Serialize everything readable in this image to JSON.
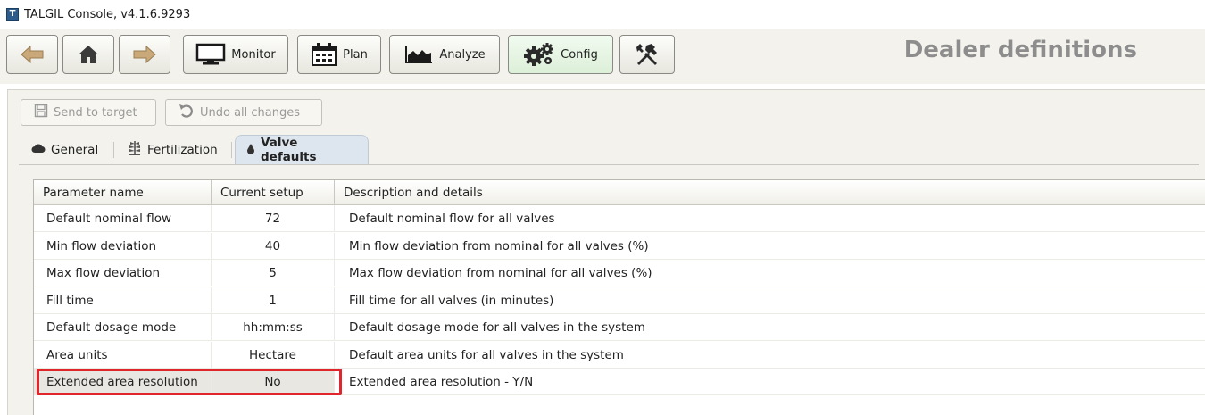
{
  "window": {
    "title": "TALGIL Console, v4.1.6.9293",
    "app_icon_glyph": "T"
  },
  "toolbar": {
    "back_icon": "arrow-left-icon",
    "home_icon": "home-icon",
    "forward_icon": "arrow-right-icon",
    "monitor_label": "Monitor",
    "plan_label": "Plan",
    "analyze_label": "Analyze",
    "config_label": "Config",
    "tools_icon": "tools-icon",
    "page_title": "Dealer definitions"
  },
  "actions": {
    "send_label": "Send to target",
    "undo_label": "Undo all changes"
  },
  "tabs": [
    {
      "label": "General",
      "icon": "cloud-icon"
    },
    {
      "label": "Fertilization",
      "icon": "plant-icon"
    },
    {
      "label": "Valve defaults",
      "icon": "drop-icon",
      "selected": true
    }
  ],
  "table": {
    "headers": [
      "Parameter name",
      "Current setup",
      "Description and details"
    ],
    "rows": [
      {
        "name": "Default nominal flow",
        "value": "72",
        "desc": "Default nominal  flow  for all valves"
      },
      {
        "name": "Min flow deviation",
        "value": "40",
        "desc": "Min flow deviation from nominal for all valves (%)"
      },
      {
        "name": "Max flow deviation",
        "value": "5",
        "desc": "Max flow deviation from nominal for all valves (%)"
      },
      {
        "name": "Fill time",
        "value": "1",
        "desc": "Fill time for all valves (in minutes)"
      },
      {
        "name": "Default dosage mode",
        "value": "hh:mm:ss",
        "desc": "Default dosage mode for all valves in the system"
      },
      {
        "name": "Area units",
        "value": "Hectare",
        "desc": "Default area units for all valves in the system"
      },
      {
        "name": "Extended area resolution",
        "value": "No",
        "desc": "Extended area resolution - Y/N"
      }
    ]
  },
  "colors": {
    "highlight": "#e0262b",
    "active_button": "#dcefd8",
    "selected_tab": "#dde6ef",
    "title_gray": "#8d8d8d"
  }
}
